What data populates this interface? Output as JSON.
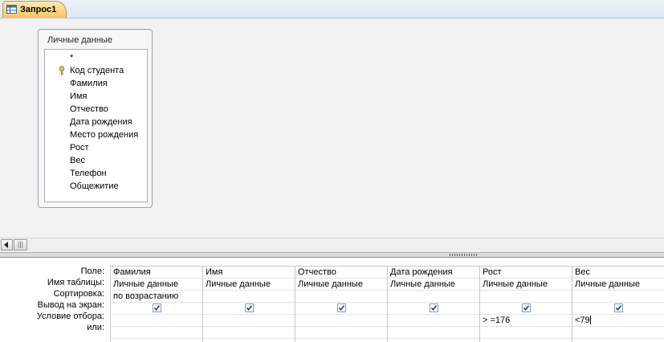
{
  "tab": {
    "label": "Запрос1",
    "icon": "query-icon"
  },
  "table": {
    "title": "Личные данные",
    "fields": [
      "*",
      "Код студента",
      "Фамилия",
      "Имя",
      "Отчество",
      "Дата рождения",
      "Место рождения",
      "Рост",
      "Вес",
      "Телефон",
      "Общежитие"
    ],
    "key_field": "Код студента"
  },
  "grid": {
    "row_labels": [
      "Поле:",
      "Имя таблицы:",
      "Сортировка:",
      "Вывод на экран:",
      "Условие отбора:",
      "или:"
    ],
    "columns": [
      {
        "field": "Фамилия",
        "table": "Личные данные",
        "sort": "по возрастанию",
        "show": true,
        "criteria": "",
        "or": ""
      },
      {
        "field": "Имя",
        "table": "Личные данные",
        "sort": "",
        "show": true,
        "criteria": "",
        "or": ""
      },
      {
        "field": "Отчество",
        "table": "Личные данные",
        "sort": "",
        "show": true,
        "criteria": "",
        "or": ""
      },
      {
        "field": "Дата рождения",
        "table": "Личные данные",
        "sort": "",
        "show": true,
        "criteria": "",
        "or": ""
      },
      {
        "field": "Рост",
        "table": "Личные данные",
        "sort": "",
        "show": true,
        "criteria": "> =176",
        "or": ""
      },
      {
        "field": "Вес",
        "table": "Личные данные",
        "sort": "",
        "show": true,
        "criteria": "<79",
        "or": ""
      }
    ]
  },
  "colors": {
    "tab_active": "#f7c65e",
    "checkbox_border": "#7f9db9",
    "check_mark": "#1f3f7a"
  }
}
